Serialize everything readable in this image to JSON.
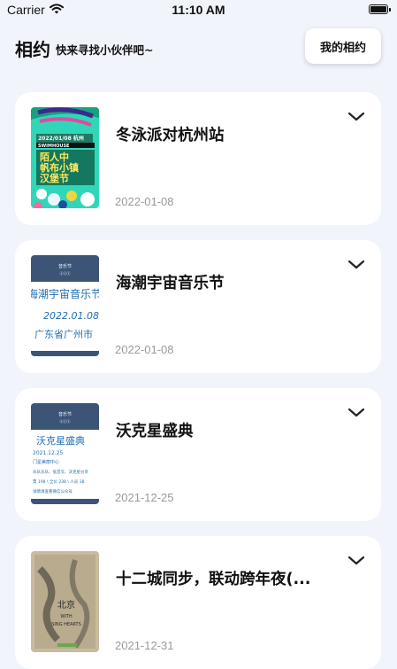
{
  "status_bar": {
    "carrier": "Carrier",
    "time": "11:10 AM"
  },
  "header": {
    "title": "相约",
    "subtitle": "快来寻找小伙伴吧~",
    "my_button": "我的相约"
  },
  "events": [
    {
      "title": "冬泳派对杭州站",
      "date": "2022-01-08"
    },
    {
      "title": "海潮宇宙音乐节",
      "date": "2022-01-08"
    },
    {
      "title": "沃克星盛典",
      "date": "2021-12-25"
    },
    {
      "title": "十二城同步，联动跨年夜(...",
      "date": "2021-12-31"
    }
  ],
  "posters": [
    {
      "lines": [
        "2022/01/08 杭州",
        "SWIMHOUSE",
        "陌人中",
        "帆布小镇",
        "汉堡节"
      ]
    },
    {
      "header": "音乐节",
      "lines": [
        "海潮宇宙音乐节",
        "2022.01.08-",
        "广东省广州市"
      ]
    },
    {
      "header": "音乐节",
      "lines": [
        "沃克星盛典",
        "2021.12.25",
        "门星美丽中心",
        "乐队乐队、低音叉、沃克星分享",
        "票 198 \\ 全价 238 \\ 人员 38",
        "详情请查看微信公众号"
      ]
    },
    {
      "lines": [
        "北京",
        "WITH",
        "SING HEARTS"
      ]
    }
  ],
  "colors": {
    "background": "#f1f4fb",
    "card": "#ffffff",
    "date": "#9a9a9a"
  }
}
